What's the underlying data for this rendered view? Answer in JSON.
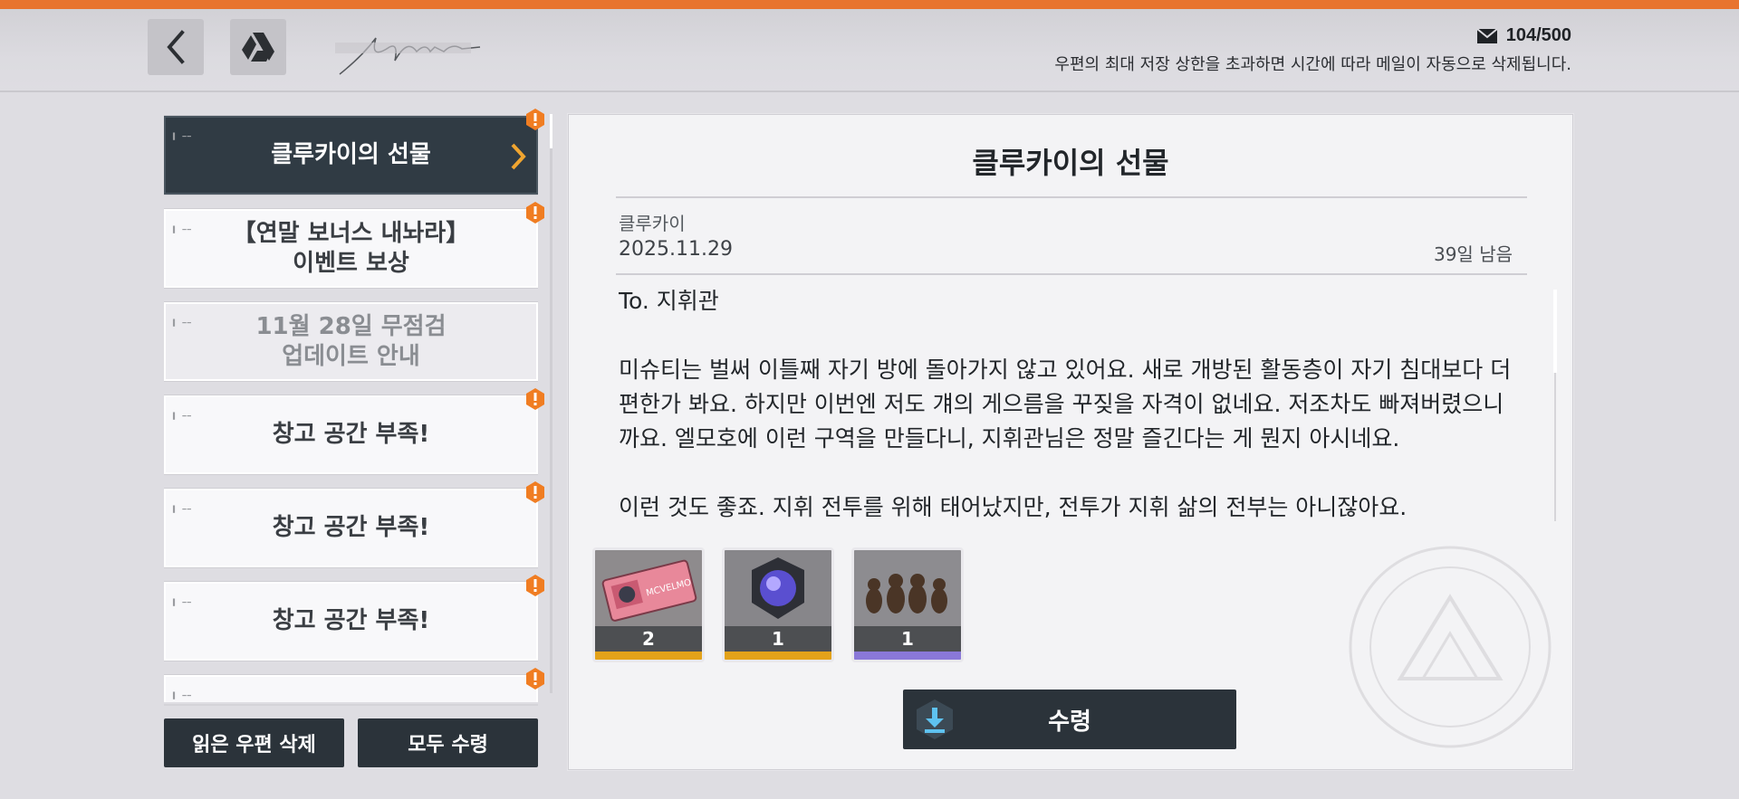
{
  "header": {
    "mail_count": "104/500",
    "notice": "우편의 최대 저장 상한을 초과하면 시간에 따라 메일이 자동으로 삭제됩니다."
  },
  "mail_list": [
    {
      "title": "클루카이의 선물",
      "selected": true,
      "unread": true
    },
    {
      "title": "【연말 보너스 내놔라】\n이벤트 보상",
      "selected": false,
      "unread": true
    },
    {
      "title": "11월 28일 무점검\n업데이트 안내",
      "selected": false,
      "unread": false
    },
    {
      "title": "창고 공간 부족!",
      "selected": false,
      "unread": true
    },
    {
      "title": "창고 공간 부족!",
      "selected": false,
      "unread": true
    },
    {
      "title": "창고 공간 부족!",
      "selected": false,
      "unread": true
    },
    {
      "title": "",
      "selected": false,
      "unread": true
    }
  ],
  "buttons": {
    "delete_read": "읽은 우편 삭제",
    "receive_all": "모두 수령",
    "claim": "수령"
  },
  "detail": {
    "title": "클루카이의 선물",
    "sender": "클루카이",
    "date": "2025.11.29",
    "remaining": "39일 남음",
    "body": "To. 지휘관\n\n미슈티는 벌써 이틀째 자기 방에 돌아가지 않고 있어요. 새로 개방된 활동층이 자기 침대보다 더 편한가 봐요. 하지만 이번엔 저도 걔의 게으름을 꾸짖을 자격이 없네요. 저조차도 빠져버렸으니까요. 엘모호에 이런 구역을 만들다니, 지휘관님은 정말 즐긴다는 게 뭔지 아시네요.\n\n이런 것도 좋죠. 지휘 전투를 위해 태어났지만, 전투가 지휘 삶의 전부는 아니잖아요."
  },
  "rewards": [
    {
      "icon": "ticket-icon",
      "quantity": "2",
      "rarity_color": "#e3a21a"
    },
    {
      "icon": "core-orb-icon",
      "quantity": "1",
      "rarity_color": "#e3a21a"
    },
    {
      "icon": "bird-figurines-icon",
      "quantity": "1",
      "rarity_color": "#8a78d8"
    }
  ],
  "colors": {
    "accent_orange": "#e8742f",
    "dark_button": "#2b333a",
    "selected_item": "#303b44",
    "alert": "#f07d22"
  }
}
